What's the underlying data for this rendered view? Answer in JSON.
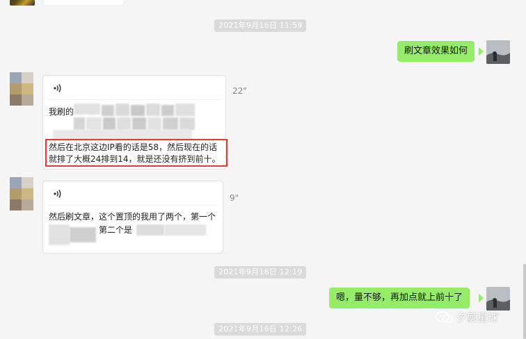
{
  "timestamps": [
    "2021年9月16日 11:59",
    "2021年9月16日 12:19",
    "2021年9月16日 12:26"
  ],
  "messages": {
    "sent_1": "刷文章效果如何",
    "voice_1": {
      "duration": "22\"",
      "text_line1": "我刷的",
      "text_line2": "然后在北京这边IP看的话是58，然后现在的话",
      "text_line3": "就排了大概24排到14，就是还没有挤到前十。"
    },
    "voice_2": {
      "duration": "9\"",
      "text_line1": "然后刷文章，这个置顶的我用了两个，第一个",
      "text_line2": "第二个是"
    },
    "sent_2": "嗯，量不够，再加点就上前十了"
  },
  "watermark": "夕颜星球",
  "colors": {
    "background": "#f5f5f5",
    "sent_bubble": "#95ec69",
    "timestamp_bg": "#dadada",
    "highlight": "#e53935"
  }
}
